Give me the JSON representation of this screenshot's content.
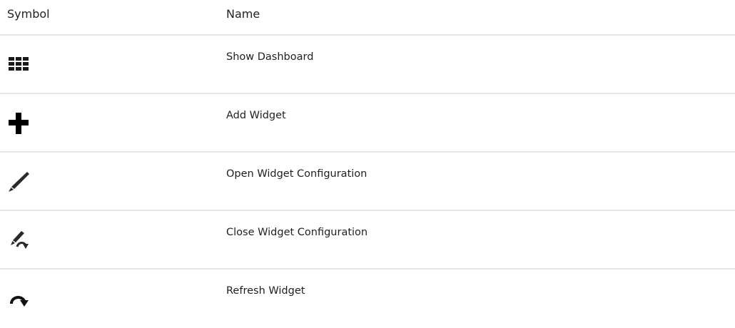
{
  "table": {
    "headers": {
      "symbol": "Symbol",
      "name": "Name"
    },
    "rows": [
      {
        "icon": "grid-icon",
        "name": "Show Dashboard"
      },
      {
        "icon": "plus-icon",
        "name": "Add Widget"
      },
      {
        "icon": "pencil-icon",
        "name": "Open Widget Configuration"
      },
      {
        "icon": "pencil-undo-icon",
        "name": "Close Widget Configuration"
      },
      {
        "icon": "refresh-icon",
        "name": "Refresh Widget"
      }
    ]
  }
}
